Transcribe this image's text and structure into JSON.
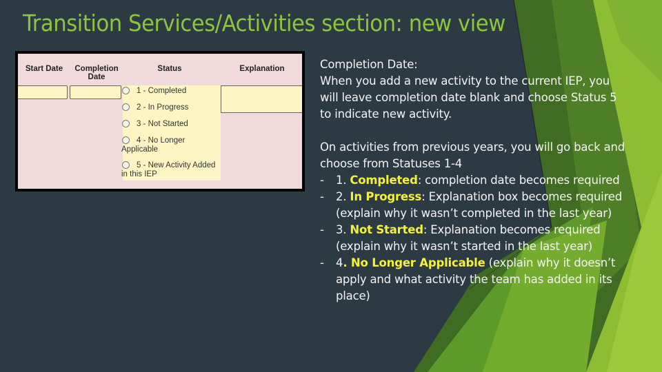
{
  "slide": {
    "title": "Transition Services/Activities section: new view",
    "colors": {
      "background": "#2c3a43",
      "title": "#8cc63e",
      "highlight": "#f5f03a",
      "body_text": "#f4f4f4",
      "form_bg": "#f2d9db",
      "input_bg": "#fdf5c4"
    }
  },
  "form": {
    "headers": {
      "start_date": "Start Date",
      "completion_date_line1": "Completion",
      "completion_date_line2": "Date",
      "status": "Status",
      "explanation": "Explanation"
    },
    "start_date_value": "",
    "completion_date_value": "",
    "explanation_value": "",
    "status_options": [
      {
        "line1": "1 - Completed",
        "line2": ""
      },
      {
        "line1": "2 - In Progress",
        "line2": ""
      },
      {
        "line1": "3 - Not Started",
        "line2": ""
      },
      {
        "line1": "4 - No Longer",
        "line2": "Applicable"
      },
      {
        "line1": "5 - New Activity Added",
        "line2": "in this IEP"
      }
    ]
  },
  "notes": {
    "heading": "Completion Date:",
    "para1": "When you add a new activity to the current IEP, you will leave completion date blank and choose Status 5 to indicate new activity.",
    "para2": "On activities from previous years, you will go back and choose from Statuses 1-4",
    "bullet_marker": "-",
    "items": [
      {
        "num": "1. ",
        "label": "Completed",
        "sep": ":",
        "text": " completion date becomes required"
      },
      {
        "num": "2. ",
        "label": "In Progress",
        "sep": ":",
        "text": " Explanation box becomes required (explain why it wasn’t completed in the last year)"
      },
      {
        "num": "3. ",
        "label": "Not Started",
        "sep": ":",
        "text": " Explanation becomes required (explain why it wasn’t started in the last year)"
      },
      {
        "num": "4",
        "label": ". No Longer Applicable",
        "sep": "",
        "text": " (explain why it doesn’t apply and what activity the team has added in its place)"
      }
    ]
  }
}
